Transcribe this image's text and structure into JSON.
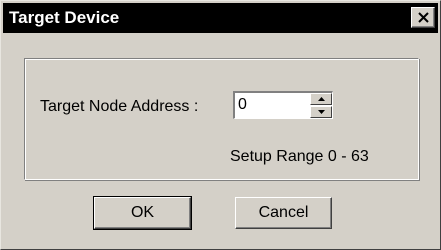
{
  "window": {
    "title": "Target Device",
    "close_glyph": "close-icon"
  },
  "form": {
    "node_address_label": "Target Node Address :",
    "node_address_value": "0",
    "setup_range": "Setup Range 0 - 63"
  },
  "buttons": {
    "ok_label": "OK",
    "cancel_label": "Cancel"
  },
  "colors": {
    "titlebar": "#000000",
    "face": "#d4d0c8"
  }
}
